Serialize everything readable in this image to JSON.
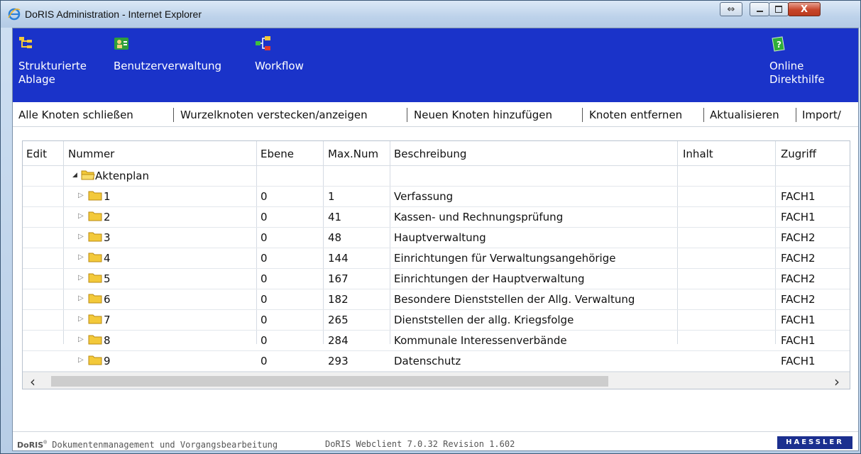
{
  "window": {
    "title": "DoRIS Administration - Internet Explorer"
  },
  "nav": {
    "items": [
      {
        "label": "Strukturierte Ablage",
        "icon": "tree-structure-icon"
      },
      {
        "label": "Benutzerverwaltung",
        "icon": "users-icon"
      },
      {
        "label": "Workflow",
        "icon": "workflow-icon"
      },
      {
        "label": "Online Direkthilfe",
        "icon": "help-icon"
      }
    ]
  },
  "toolbar": {
    "items": [
      "Alle Knoten schließen",
      "Wurzelknoten verstecken/anzeigen",
      "Neuen Knoten hinzufügen",
      "Knoten entfernen",
      "Aktualisieren",
      "Import/"
    ]
  },
  "grid": {
    "columns": [
      "Edit",
      "Nummer",
      "Ebene",
      "Max.Num",
      "Beschreibung",
      "Inhalt",
      "Zugriff"
    ],
    "root": {
      "label": "Aktenplan"
    },
    "rows": [
      {
        "nummer": "1",
        "ebene": "0",
        "maxnum": "1",
        "beschreibung": "Verfassung",
        "inhalt": "",
        "zugriff": "FACH1"
      },
      {
        "nummer": "2",
        "ebene": "0",
        "maxnum": "41",
        "beschreibung": "Kassen- und Rechnungsprüfung",
        "inhalt": "",
        "zugriff": "FACH1"
      },
      {
        "nummer": "3",
        "ebene": "0",
        "maxnum": "48",
        "beschreibung": "Hauptverwaltung",
        "inhalt": "",
        "zugriff": "FACH2"
      },
      {
        "nummer": "4",
        "ebene": "0",
        "maxnum": "144",
        "beschreibung": "Einrichtungen für Verwaltungsangehörige",
        "inhalt": "",
        "zugriff": "FACH2"
      },
      {
        "nummer": "5",
        "ebene": "0",
        "maxnum": "167",
        "beschreibung": "Einrichtungen der Hauptverwaltung",
        "inhalt": "",
        "zugriff": "FACH2"
      },
      {
        "nummer": "6",
        "ebene": "0",
        "maxnum": "182",
        "beschreibung": "Besondere Dienststellen der Allg. Verwaltung",
        "inhalt": "",
        "zugriff": "FACH2"
      },
      {
        "nummer": "7",
        "ebene": "0",
        "maxnum": "265",
        "beschreibung": "Dienststellen der allg. Kriegsfolge",
        "inhalt": "",
        "zugriff": "FACH1"
      },
      {
        "nummer": "8",
        "ebene": "0",
        "maxnum": "284",
        "beschreibung": "Kommunale Interessenverbände",
        "inhalt": "",
        "zugriff": "FACH1"
      },
      {
        "nummer": "9",
        "ebene": "0",
        "maxnum": "293",
        "beschreibung": "Datenschutz",
        "inhalt": "",
        "zugriff": "FACH1"
      }
    ]
  },
  "footer": {
    "product": "DoRIS",
    "product_desc": "Dokumentenmanagement und Vorgangsbearbeitung",
    "version": "DoRIS Webclient 7.0.32 Revision 1.602",
    "brand": "HAESSLER"
  },
  "colors": {
    "nav_bg": "#1a33c9",
    "folder": "#f3c93a"
  }
}
